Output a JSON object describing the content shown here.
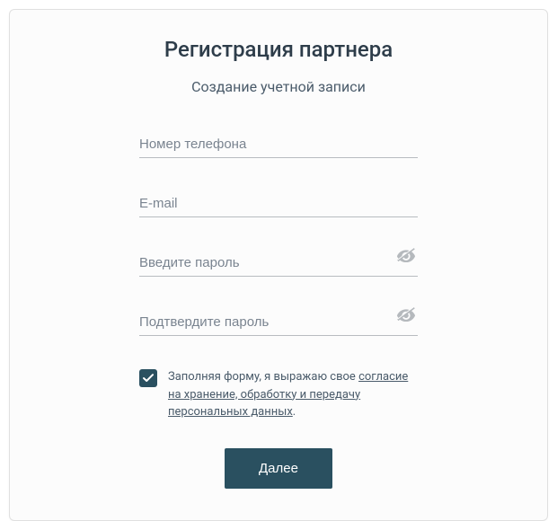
{
  "title": "Регистрация партнера",
  "subtitle": "Создание учетной записи",
  "fields": {
    "phone": {
      "placeholder": "Номер телефона",
      "value": ""
    },
    "email": {
      "placeholder": "E-mail",
      "value": ""
    },
    "password": {
      "placeholder": "Введите пароль",
      "value": ""
    },
    "password_confirm": {
      "placeholder": "Подтвердите пароль",
      "value": ""
    }
  },
  "consent": {
    "checked": true,
    "text_prefix": "Заполняя форму, я выражаю свое ",
    "link_text": "согласие на хранение, обработку и передачу персональных данных",
    "text_suffix": "."
  },
  "submit_label": "Далее"
}
